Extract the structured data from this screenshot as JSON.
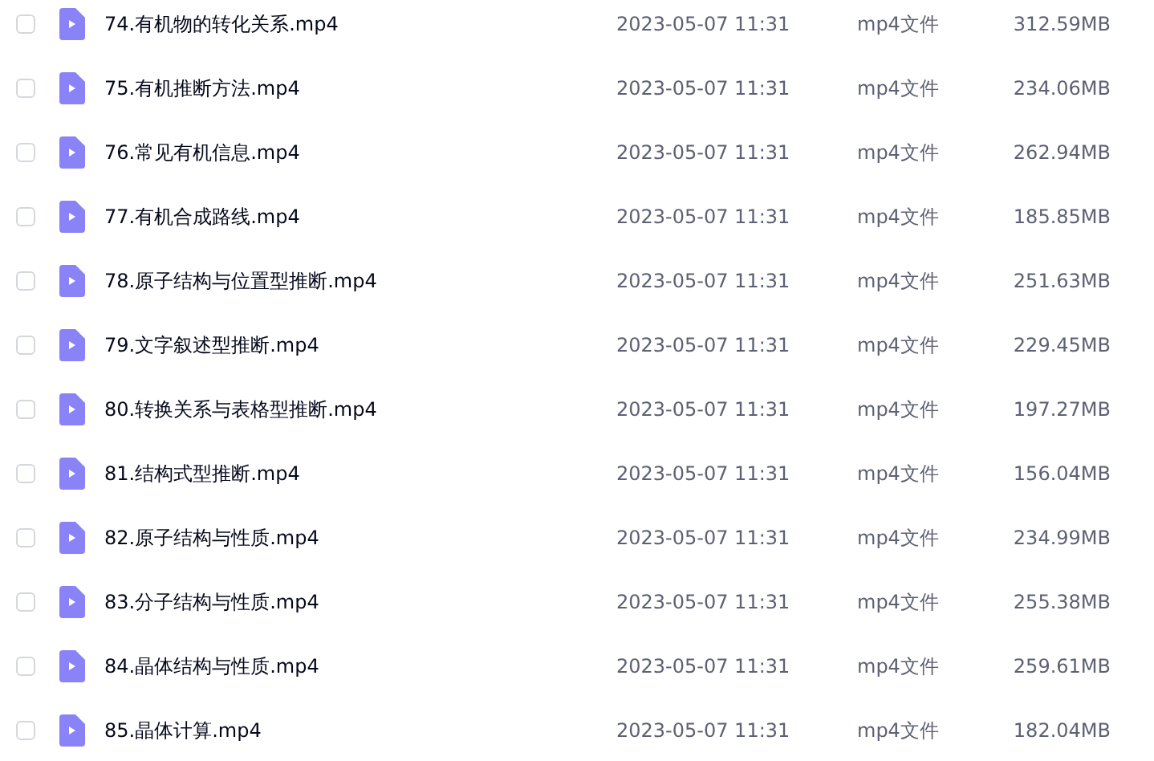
{
  "files": [
    {
      "name": "74.有机物的转化关系.mp4",
      "modified": "2023-05-07 11:31",
      "type": "mp4文件",
      "size": "312.59MB",
      "checked": false
    },
    {
      "name": "75.有机推断方法.mp4",
      "modified": "2023-05-07 11:31",
      "type": "mp4文件",
      "size": "234.06MB",
      "checked": false
    },
    {
      "name": "76.常见有机信息.mp4",
      "modified": "2023-05-07 11:31",
      "type": "mp4文件",
      "size": "262.94MB",
      "checked": false
    },
    {
      "name": "77.有机合成路线.mp4",
      "modified": "2023-05-07 11:31",
      "type": "mp4文件",
      "size": "185.85MB",
      "checked": false
    },
    {
      "name": "78.原子结构与位置型推断.mp4",
      "modified": "2023-05-07 11:31",
      "type": "mp4文件",
      "size": "251.63MB",
      "checked": false
    },
    {
      "name": "79.文字叙述型推断.mp4",
      "modified": "2023-05-07 11:31",
      "type": "mp4文件",
      "size": "229.45MB",
      "checked": false
    },
    {
      "name": "80.转换关系与表格型推断.mp4",
      "modified": "2023-05-07 11:31",
      "type": "mp4文件",
      "size": "197.27MB",
      "checked": false
    },
    {
      "name": "81.结构式型推断.mp4",
      "modified": "2023-05-07 11:31",
      "type": "mp4文件",
      "size": "156.04MB",
      "checked": false
    },
    {
      "name": "82.原子结构与性质.mp4",
      "modified": "2023-05-07 11:31",
      "type": "mp4文件",
      "size": "234.99MB",
      "checked": false
    },
    {
      "name": "83.分子结构与性质.mp4",
      "modified": "2023-05-07 11:31",
      "type": "mp4文件",
      "size": "255.38MB",
      "checked": false
    },
    {
      "name": "84.晶体结构与性质.mp4",
      "modified": "2023-05-07 11:31",
      "type": "mp4文件",
      "size": "259.61MB",
      "checked": false
    },
    {
      "name": "85.晶体计算.mp4",
      "modified": "2023-05-07 11:31",
      "type": "mp4文件",
      "size": "182.04MB",
      "checked": false
    }
  ]
}
